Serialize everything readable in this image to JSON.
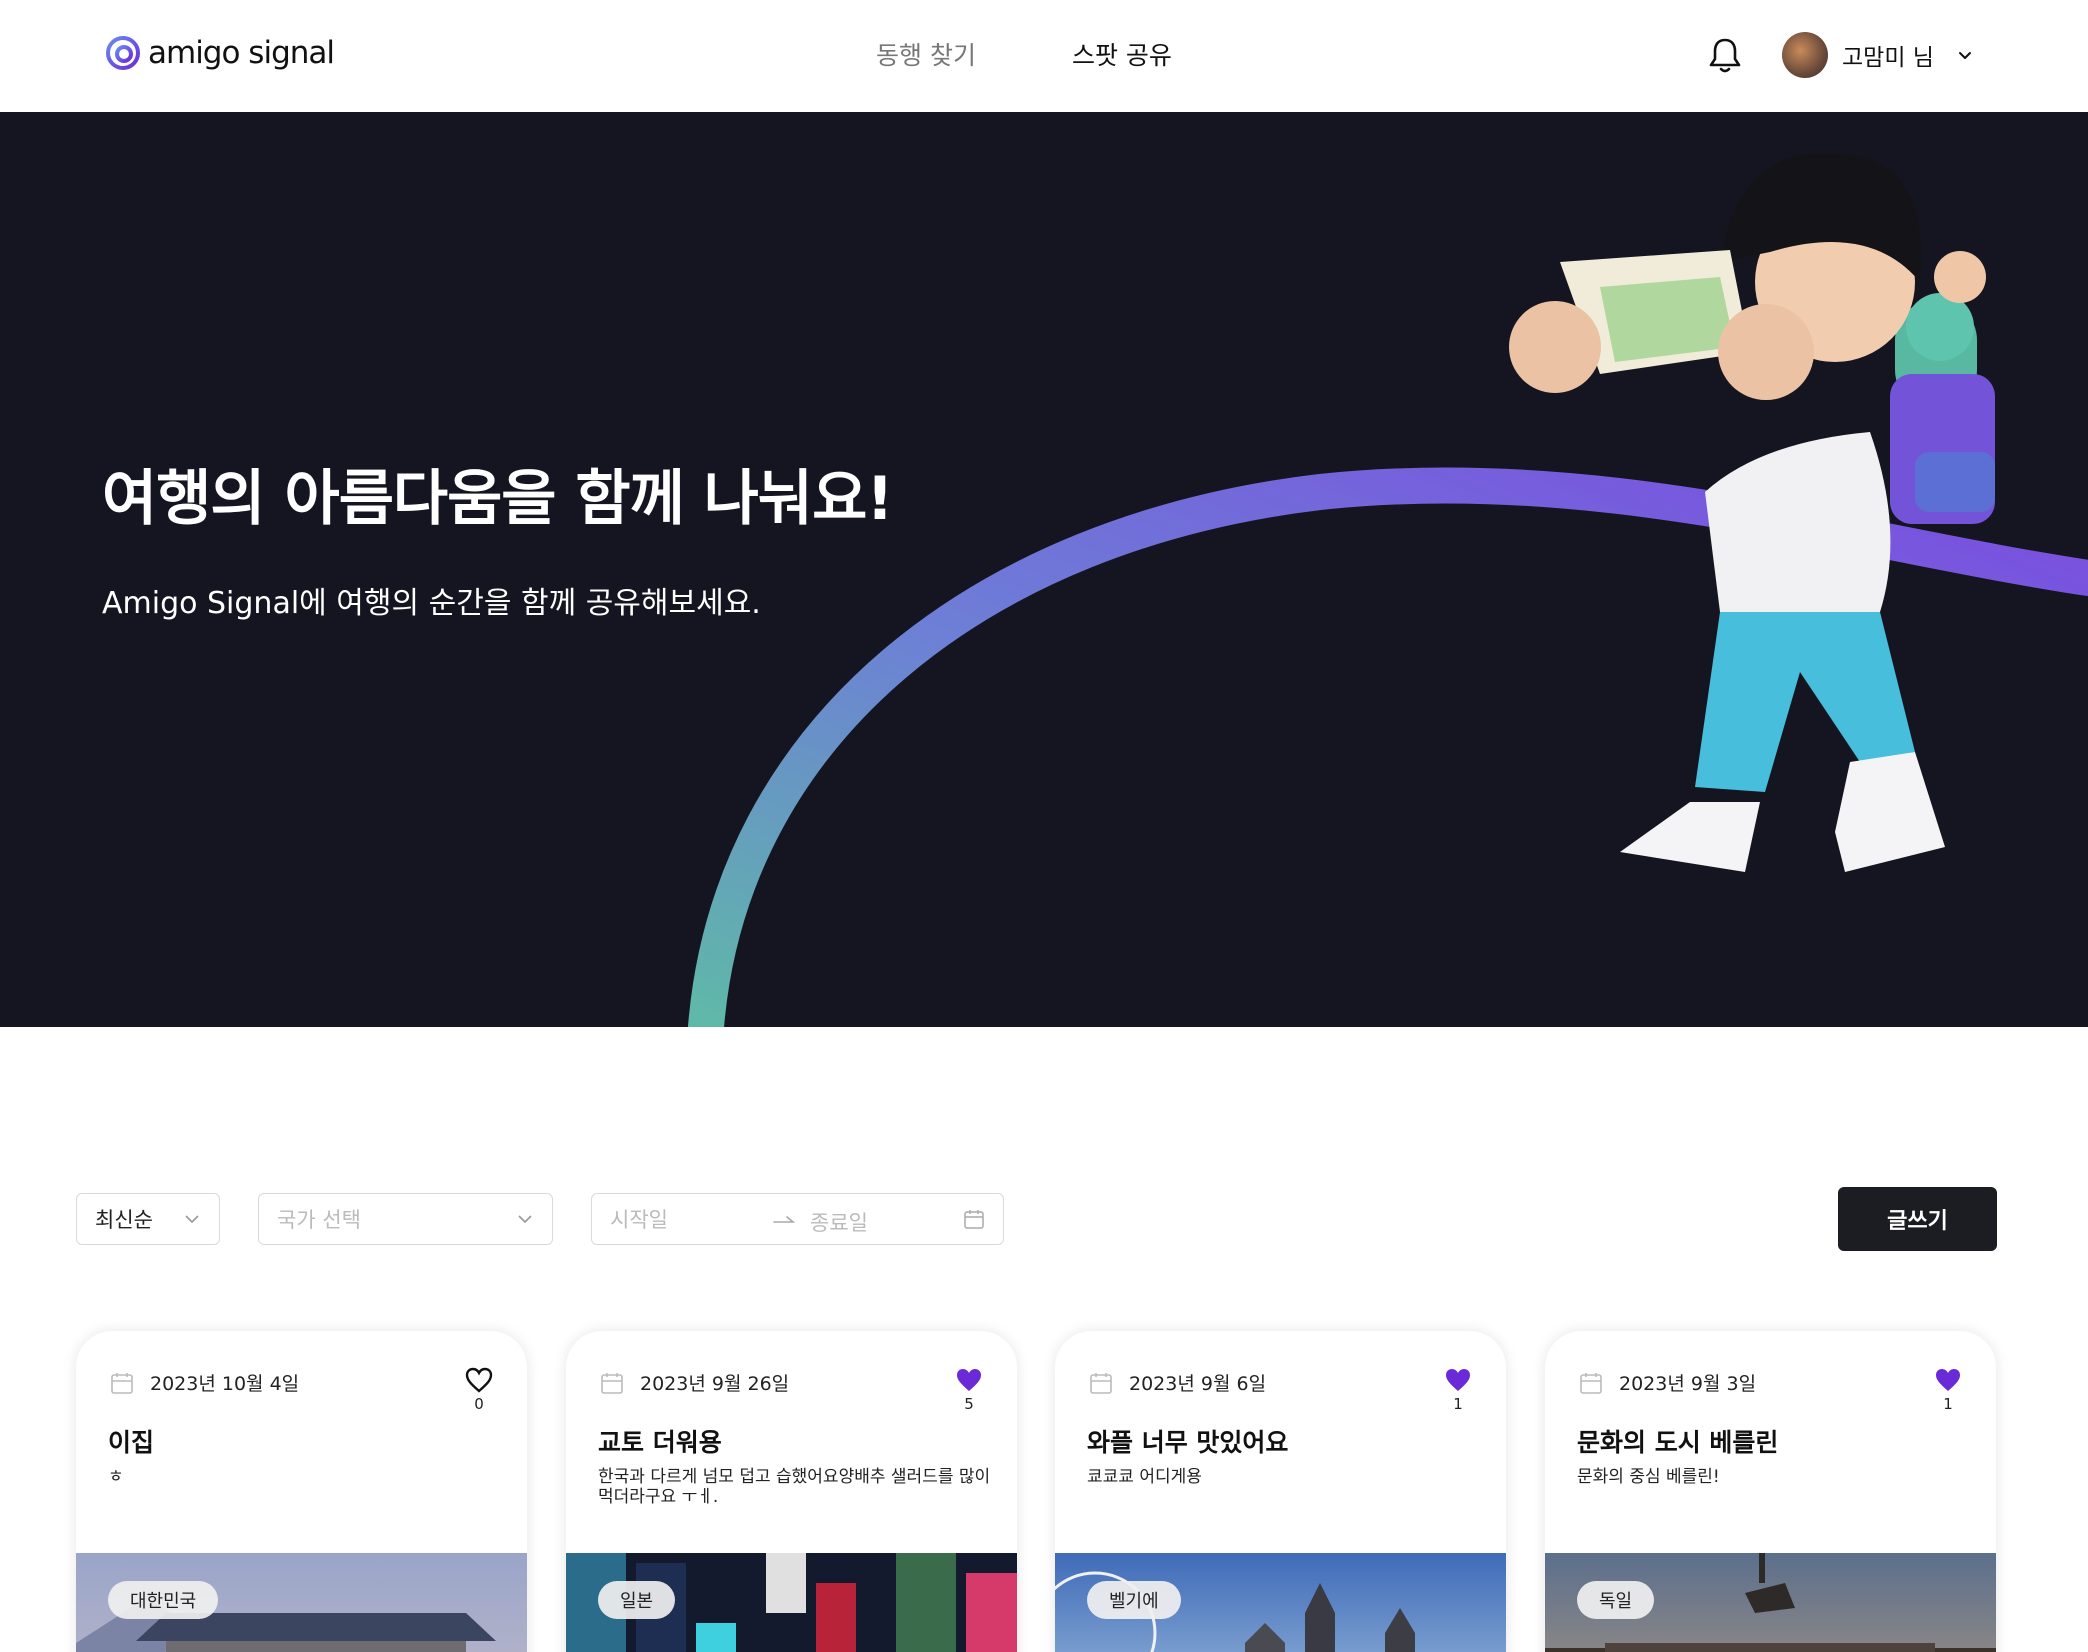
{
  "header": {
    "logo_text": "amigo signal",
    "nav": [
      {
        "label": "동행 찾기",
        "active": false
      },
      {
        "label": "스팟 공유",
        "active": true
      }
    ],
    "user": {
      "name": "고맘미 님"
    },
    "icons": {
      "bell": "bell-icon",
      "chevron": "chevron-down-icon"
    }
  },
  "hero": {
    "title": "여행의 아름다움을 함께 나눠요!",
    "subtitle": "Amigo Signal에 여행의 순간을 함께 공유해보세요."
  },
  "filters": {
    "sort_value": "최신순",
    "country_placeholder": "국가 선택",
    "start_placeholder": "시작일",
    "end_placeholder": "종료일",
    "write_label": "글쓰기"
  },
  "cards": [
    {
      "date": "2023년 10월 4일",
      "likes": "0",
      "liked": false,
      "title": "이집",
      "description": "ㅎ",
      "country": "대한민국"
    },
    {
      "date": "2023년 9월 26일",
      "likes": "5",
      "liked": true,
      "title": "교토 더워용",
      "description": "한국과 다르게 넘모 덥고 습했어요양배추 샐러드를 많이 먹더라구요 ㅜㅔ.",
      "country": "일본"
    },
    {
      "date": "2023년 9월 6일",
      "likes": "1",
      "liked": true,
      "title": "와플 너무 맛있어요",
      "description": "쿄쿄쿄 어디게용",
      "country": "벨기에"
    },
    {
      "date": "2023년 9월 3일",
      "likes": "1",
      "liked": true,
      "title": "문화의 도시 베를린",
      "description": "문화의 중심 베를린!",
      "country": "독일"
    }
  ],
  "colors": {
    "hero_bg": "#151521",
    "accent": "#6b2ad8",
    "button_dark": "#1c1d22",
    "arc_start": "#5fb9a8",
    "arc_end": "#7b4be0"
  }
}
